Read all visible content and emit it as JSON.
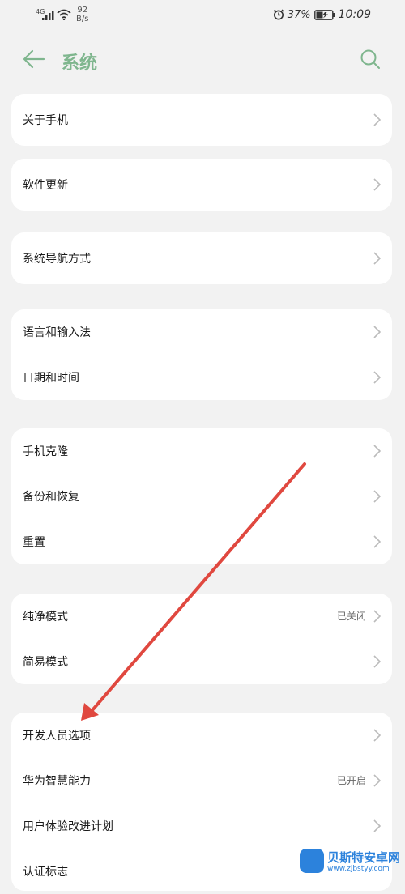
{
  "status_bar": {
    "network": "4G",
    "speed_value": "92",
    "speed_unit": "B/s",
    "battery_pct": "37%",
    "time": "10:09"
  },
  "header": {
    "title": "系统"
  },
  "cards": [
    {
      "rows": [
        {
          "label": "关于手机"
        }
      ]
    },
    {
      "rows": [
        {
          "label": "软件更新"
        }
      ]
    },
    {
      "rows": [
        {
          "label": "系统导航方式"
        }
      ]
    },
    {
      "rows": [
        {
          "label": "语言和输入法"
        },
        {
          "label": "日期和时间"
        }
      ]
    },
    {
      "rows": [
        {
          "label": "手机克隆"
        },
        {
          "label": "备份和恢复"
        },
        {
          "label": "重置"
        }
      ]
    },
    {
      "rows": [
        {
          "label": "纯净模式",
          "value": "已关闭"
        },
        {
          "label": "简易模式"
        }
      ]
    },
    {
      "rows": [
        {
          "label": "开发人员选项"
        },
        {
          "label": "华为智慧能力",
          "value": "已开启"
        },
        {
          "label": "用户体验改进计划"
        },
        {
          "label": "认证标志"
        }
      ]
    }
  ],
  "watermark": {
    "name": "贝斯特安卓网",
    "url": "www.zjbstyy.com"
  },
  "colors": {
    "accent_green": "#7fb68e",
    "annotation_arrow": "#e0483f",
    "background": "#f2f2f2",
    "card": "#ffffff",
    "watermark_blue": "#2c82dc"
  },
  "icons": [
    "back-arrow-icon",
    "search-icon",
    "chevron-right-icon",
    "signal-icon",
    "wifi-icon",
    "alarm-icon",
    "battery-charging-icon"
  ]
}
